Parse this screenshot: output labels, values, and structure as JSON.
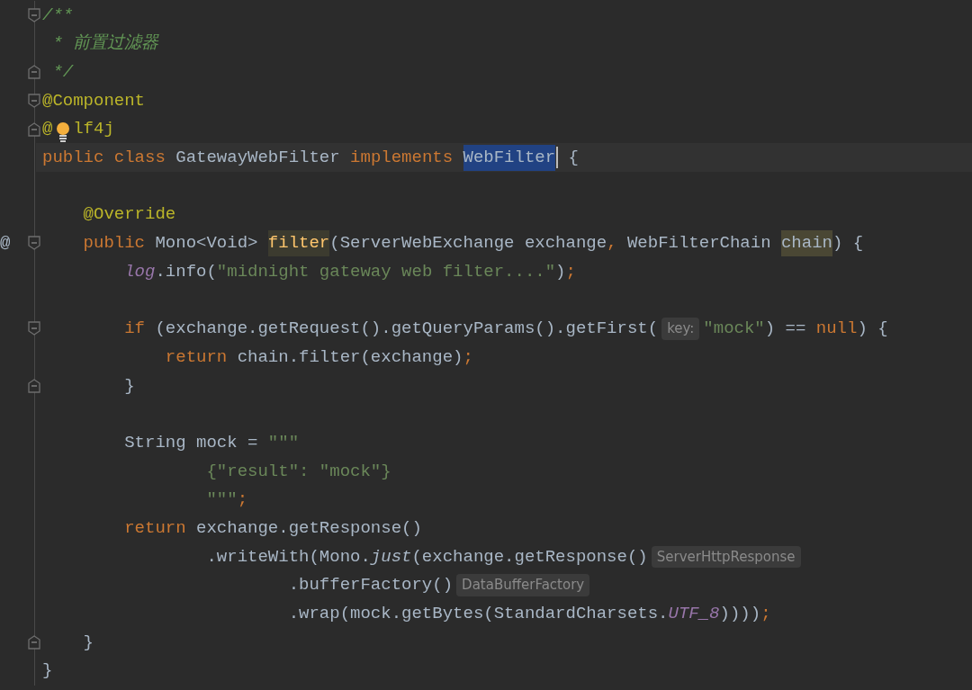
{
  "editor": {
    "lines": [
      {
        "fold_open": true,
        "tokens": [
          {
            "kind": "comment",
            "text": "/**"
          }
        ]
      },
      {
        "tokens": [
          {
            "kind": "comment",
            "text": " * 前置过滤器"
          }
        ]
      },
      {
        "fold_close": true,
        "tokens": [
          {
            "kind": "comment",
            "text": " */"
          }
        ]
      },
      {
        "fold_open": true,
        "tokens": [
          {
            "kind": "annotation",
            "text": "@Component"
          }
        ]
      },
      {
        "fold_close": true,
        "tokens": [
          {
            "kind": "annotation",
            "text": "@"
          },
          {
            "kind": "bulb"
          },
          {
            "kind": "annotation",
            "text": "lf4j"
          }
        ]
      },
      {
        "current": true,
        "tokens": [
          {
            "kind": "keyword",
            "text": "public class "
          },
          {
            "kind": "plain",
            "text": "GatewayWebFilter "
          },
          {
            "kind": "keyword",
            "text": "implements "
          },
          {
            "kind": "selection",
            "text": "WebFilter"
          },
          {
            "kind": "plain",
            "text": " {"
          }
        ]
      },
      {
        "blank_before": true,
        "tokens": [
          {
            "kind": "annotation",
            "text": "    @Override"
          }
        ]
      },
      {
        "gutter": "@",
        "fold_open": true,
        "tokens": [
          {
            "kind": "keyword",
            "text": "    public "
          },
          {
            "kind": "plain",
            "text": "Mono<Void> "
          },
          {
            "kind": "declaration",
            "text": "filter"
          },
          {
            "kind": "plain",
            "text": "(ServerWebExchange exchange"
          },
          {
            "kind": "keyword",
            "text": ", "
          },
          {
            "kind": "plain",
            "text": "WebFilterChain "
          },
          {
            "kind": "usage",
            "text": "chain"
          },
          {
            "kind": "plain",
            "text": ") {"
          }
        ]
      },
      {
        "tokens": [
          {
            "kind": "field",
            "text": "        log"
          },
          {
            "kind": "plain",
            "text": ".info("
          },
          {
            "kind": "string",
            "text": "\"midnight gateway web filter....\""
          },
          {
            "kind": "plain",
            "text": ")"
          },
          {
            "kind": "keyword",
            "text": ";"
          }
        ]
      },
      {
        "blank_before": true,
        "fold_open": true,
        "tokens": [
          {
            "kind": "keyword",
            "text": "        if "
          },
          {
            "kind": "plain",
            "text": "(exchange.getRequest().getQueryParams().getFirst("
          },
          {
            "kind": "hint",
            "text": "key:"
          },
          {
            "kind": "string",
            "text": "\"mock\""
          },
          {
            "kind": "plain",
            "text": ") == "
          },
          {
            "kind": "keyword",
            "text": "null"
          },
          {
            "kind": "plain",
            "text": ") {"
          }
        ]
      },
      {
        "tokens": [
          {
            "kind": "keyword",
            "text": "            return "
          },
          {
            "kind": "plain",
            "text": "chain.filter(exchange)"
          },
          {
            "kind": "keyword",
            "text": ";"
          }
        ]
      },
      {
        "fold_close": true,
        "tokens": [
          {
            "kind": "plain",
            "text": "        }"
          }
        ]
      },
      {
        "blank_before": true,
        "tokens": [
          {
            "kind": "plain",
            "text": "        String mock = "
          },
          {
            "kind": "string",
            "text": "\"\"\""
          }
        ]
      },
      {
        "tokens": [
          {
            "kind": "string",
            "text": "                {\"result\": \"mock\"}"
          }
        ]
      },
      {
        "tokens": [
          {
            "kind": "string",
            "text": "                \"\"\""
          },
          {
            "kind": "keyword",
            "text": ";"
          }
        ]
      },
      {
        "tokens": [
          {
            "kind": "keyword",
            "text": "        return "
          },
          {
            "kind": "plain",
            "text": "exchange.getResponse()"
          }
        ]
      },
      {
        "tokens": [
          {
            "kind": "plain",
            "text": "                .writeWith(Mono."
          },
          {
            "kind": "static",
            "text": "just"
          },
          {
            "kind": "plain",
            "text": "(exchange.getResponse()"
          },
          {
            "kind": "hint",
            "text": "ServerHttpResponse"
          }
        ]
      },
      {
        "tokens": [
          {
            "kind": "plain",
            "text": "                        .bufferFactory()"
          },
          {
            "kind": "hint",
            "text": "DataBufferFactory"
          }
        ]
      },
      {
        "tokens": [
          {
            "kind": "plain",
            "text": "                        .wrap(mock.getBytes(StandardCharsets."
          },
          {
            "kind": "field",
            "text": "UTF_8"
          },
          {
            "kind": "plain",
            "text": "))))"
          },
          {
            "kind": "keyword",
            "text": ";"
          }
        ]
      },
      {
        "fold_close": true,
        "tokens": [
          {
            "kind": "plain",
            "text": "    }"
          }
        ]
      },
      {
        "tokens": [
          {
            "kind": "plain",
            "text": "}"
          }
        ]
      }
    ]
  }
}
